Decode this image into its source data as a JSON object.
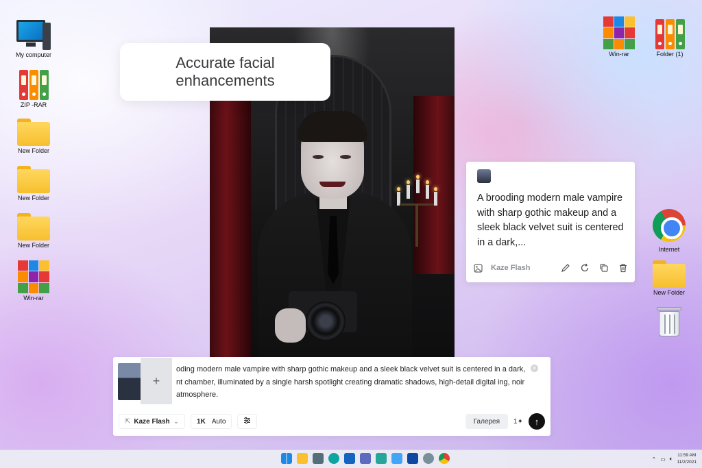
{
  "desktop": {
    "icons_left": [
      {
        "label": "My computer",
        "icon": "computer-icon"
      },
      {
        "label": "ZIP -RAR",
        "icon": "binders-icon"
      },
      {
        "label": "New Folder",
        "icon": "folder-icon"
      },
      {
        "label": "New Folder",
        "icon": "folder-icon"
      },
      {
        "label": "New Folder",
        "icon": "folder-icon"
      },
      {
        "label": "Win-rar",
        "icon": "winrar-icon"
      }
    ],
    "icons_right": [
      {
        "label": "Win-rar",
        "icon": "winrar-icon"
      },
      {
        "label": "Folder (1)",
        "icon": "binders-icon"
      },
      {
        "label": "Internet",
        "icon": "chrome-icon"
      },
      {
        "label": "New Folder",
        "icon": "folder-icon"
      },
      {
        "label": "",
        "icon": "recycle-bin-icon"
      }
    ]
  },
  "callout": {
    "text": "Accurate facial enhancements"
  },
  "prompt_card": {
    "text": "A brooding modern male vampire with sharp gothic makeup and a sleek black velvet suit is centered in a dark,...",
    "model": "Kaze Flash",
    "actions": [
      "edit-icon",
      "regenerate-icon",
      "copy-icon",
      "delete-icon"
    ]
  },
  "composer": {
    "prompt": "oding modern male vampire with sharp gothic makeup and a sleek black velvet suit is centered in a dark, nt chamber, illuminated by a single harsh spotlight creating dramatic shadows, high-detail digital ing, noir atmosphere.",
    "add_label": "+",
    "model": "Kaze Flash",
    "resolution": "1K",
    "aspect": "Auto",
    "gallery": "Галерея",
    "count": "1"
  },
  "taskbar": {
    "time": "11:59 AM",
    "date": "11/2/2021"
  },
  "colors": {
    "accent": "#111111",
    "card_bg": "#ffffff"
  }
}
